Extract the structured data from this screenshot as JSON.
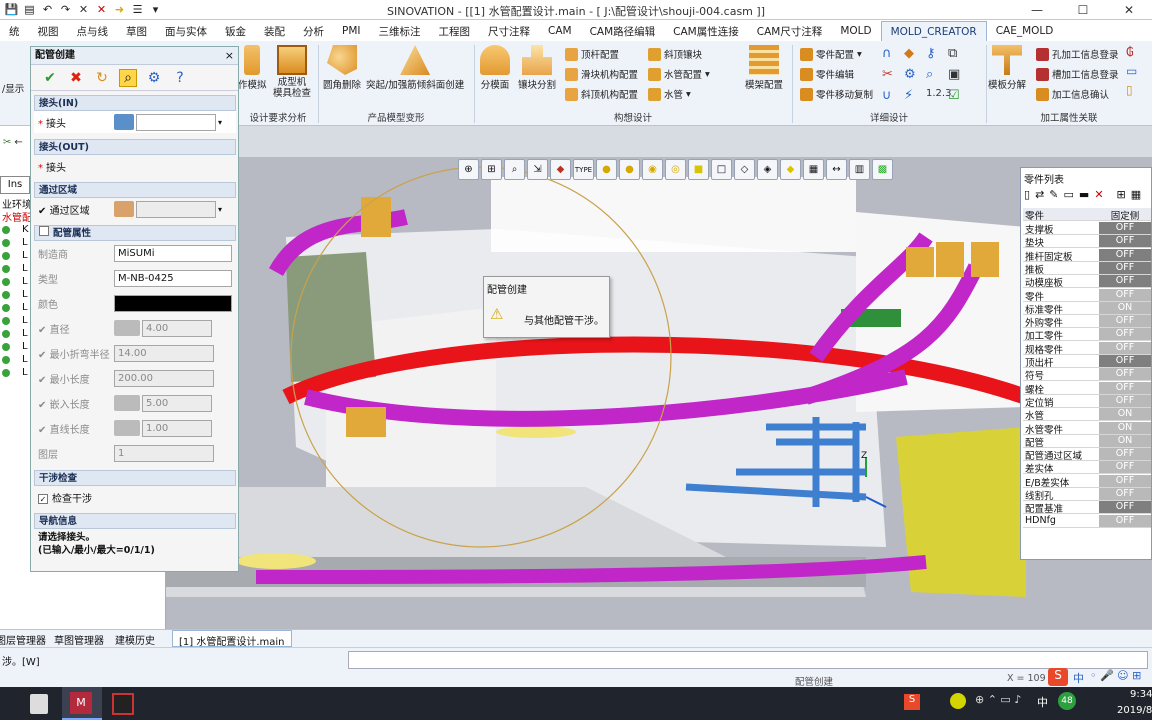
{
  "window": {
    "title": "SINOVATION - [[1] 水管配置设计.main - [ J:\\配管设计\\shouji-004.casm ]]",
    "controls": [
      "—",
      "☐",
      "✕"
    ]
  },
  "menu_tabs": [
    "统",
    "视图",
    "点与线",
    "草图",
    "面与实体",
    "钣金",
    "装配",
    "分析",
    "PMI",
    "三维标注",
    "工程图",
    "尺寸注释",
    "CAM",
    "CAM路径编辑",
    "CAM属性连接",
    "CAM尺寸注释",
    "MOLD",
    "MOLD_CREATOR",
    "CAE_MOLD"
  ],
  "active_tab": "MOLD_CREATOR",
  "ribbon": {
    "partial_left": [
      "/显示"
    ],
    "large_buttons": [
      {
        "label": "作模拟"
      },
      {
        "label": "成型机\n模具检查"
      },
      {
        "label": "圆角删除"
      },
      {
        "label": "突起/加强筋倾斜面创建"
      },
      {
        "label": "分模面"
      },
      {
        "label": "镶块分割"
      },
      {
        "label": "模架配置"
      },
      {
        "label": "模板分解"
      }
    ],
    "small_buttons": [
      {
        "label": "顶杆配置"
      },
      {
        "label": "滑块机构配置"
      },
      {
        "label": "斜顶机构配置"
      },
      {
        "label": "斜顶镶块"
      },
      {
        "label": "水管配置"
      },
      {
        "label": "水管"
      },
      {
        "label": "零件配置"
      },
      {
        "label": "零件编辑"
      },
      {
        "label": "零件移动复制"
      },
      {
        "label": "孔加工信息登录"
      },
      {
        "label": "槽加工信息登录"
      },
      {
        "label": "加工信息确认"
      }
    ],
    "groups": [
      {
        "label": "设计要求分析"
      },
      {
        "label": "产品模型变形"
      },
      {
        "label": "构想设计"
      },
      {
        "label": "详细设计"
      },
      {
        "label": "加工属性关联"
      }
    ]
  },
  "left_panel": {
    "tab": "Ins",
    "items": [
      "业环境",
      "水管配"
    ],
    "row_labels": [
      "K",
      "L",
      "L",
      "L",
      "L",
      "L",
      "L",
      "L",
      "L",
      "L",
      "L",
      "L"
    ]
  },
  "dialog": {
    "title": "配管创建",
    "close": "×",
    "toolbar_icons": [
      "ok-icon",
      "cancel-icon",
      "undo-icon",
      "search-icon",
      "settings-icon",
      "help-icon"
    ],
    "sections": {
      "in": "接头(IN)",
      "out": "接头(OUT)",
      "pass": "通过区域",
      "props": "配管属性",
      "interf": "干涉检查",
      "nav": "导航信息"
    },
    "fields": {
      "in_joint": {
        "label": "接头",
        "value": ""
      },
      "out_joint": {
        "label": "接头"
      },
      "pass_area": {
        "label": "通过区域",
        "value": ""
      },
      "maker": {
        "label": "制造商",
        "value": "MiSUMi"
      },
      "type": {
        "label": "类型",
        "value": "M-NB-0425"
      },
      "color": {
        "label": "颜色",
        "value": "#000000"
      },
      "diameter": {
        "label": "直径",
        "value": "4.00"
      },
      "min_bend": {
        "label": "最小折弯半径",
        "value": "14.00"
      },
      "min_len": {
        "label": "最小长度",
        "value": "200.00"
      },
      "insert_len": {
        "label": "嵌入长度",
        "value": "5.00"
      },
      "straight_len": {
        "label": "直线长度",
        "value": "1.00"
      },
      "layer": {
        "label": "图层",
        "value": "1"
      },
      "check_interf": {
        "label": "检查干涉",
        "checked": true
      }
    },
    "nav_text": [
      "请选择接头。",
      "(已输入/最小/最大=0/1/1)"
    ]
  },
  "alert": {
    "title": "配管创建",
    "message": "与其他配管干涉。"
  },
  "parts_list": {
    "title": "零件列表",
    "headers": [
      "零件",
      "固定侧"
    ],
    "rows": [
      {
        "name": "支撑板",
        "value": "OFF",
        "dark": true
      },
      {
        "name": "垫块",
        "value": "OFF",
        "dark": true
      },
      {
        "name": "推杆固定板",
        "value": "OFF",
        "dark": true
      },
      {
        "name": "推板",
        "value": "OFF",
        "dark": true
      },
      {
        "name": "动模座板",
        "value": "OFF",
        "dark": true
      },
      {
        "name": "零件",
        "value": "OFF",
        "dark": false
      },
      {
        "name": "标准零件",
        "value": "ON",
        "dark": false
      },
      {
        "name": "外购零件",
        "value": "OFF",
        "dark": false
      },
      {
        "name": "加工零件",
        "value": "OFF",
        "dark": false
      },
      {
        "name": "规格零件",
        "value": "OFF",
        "dark": false
      },
      {
        "name": "顶出杆",
        "value": "OFF",
        "dark": true
      },
      {
        "name": "符号",
        "value": "OFF",
        "dark": false
      },
      {
        "name": "螺栓",
        "value": "OFF",
        "dark": false
      },
      {
        "name": "定位销",
        "value": "OFF",
        "dark": false
      },
      {
        "name": "水管",
        "value": "ON",
        "dark": false
      },
      {
        "name": "水管零件",
        "value": "ON",
        "dark": false
      },
      {
        "name": "配管",
        "value": "ON",
        "dark": false
      },
      {
        "name": "配管通过区域",
        "value": "OFF",
        "dark": false
      },
      {
        "name": "差实体",
        "value": "OFF",
        "dark": false
      },
      {
        "name": "E/B差实体",
        "value": "OFF",
        "dark": false
      },
      {
        "name": "线割孔",
        "value": "OFF",
        "dark": false
      },
      {
        "name": "配置基准",
        "value": "OFF",
        "dark": true
      },
      {
        "name": "HDNfg",
        "value": "OFF",
        "dark": false
      }
    ]
  },
  "viewport": {
    "axis_label": "Z"
  },
  "bottom_tabs": [
    "图层管理器",
    "草图管理器",
    "建模历史",
    "[1] 水管配置设计.main"
  ],
  "status": {
    "left": "涉。[W]",
    "center": "配管创建",
    "coord": "X = 109"
  },
  "taskbar": {
    "time": "9:34",
    "date": "2019/8/",
    "ime": "中",
    "badge": "48"
  }
}
